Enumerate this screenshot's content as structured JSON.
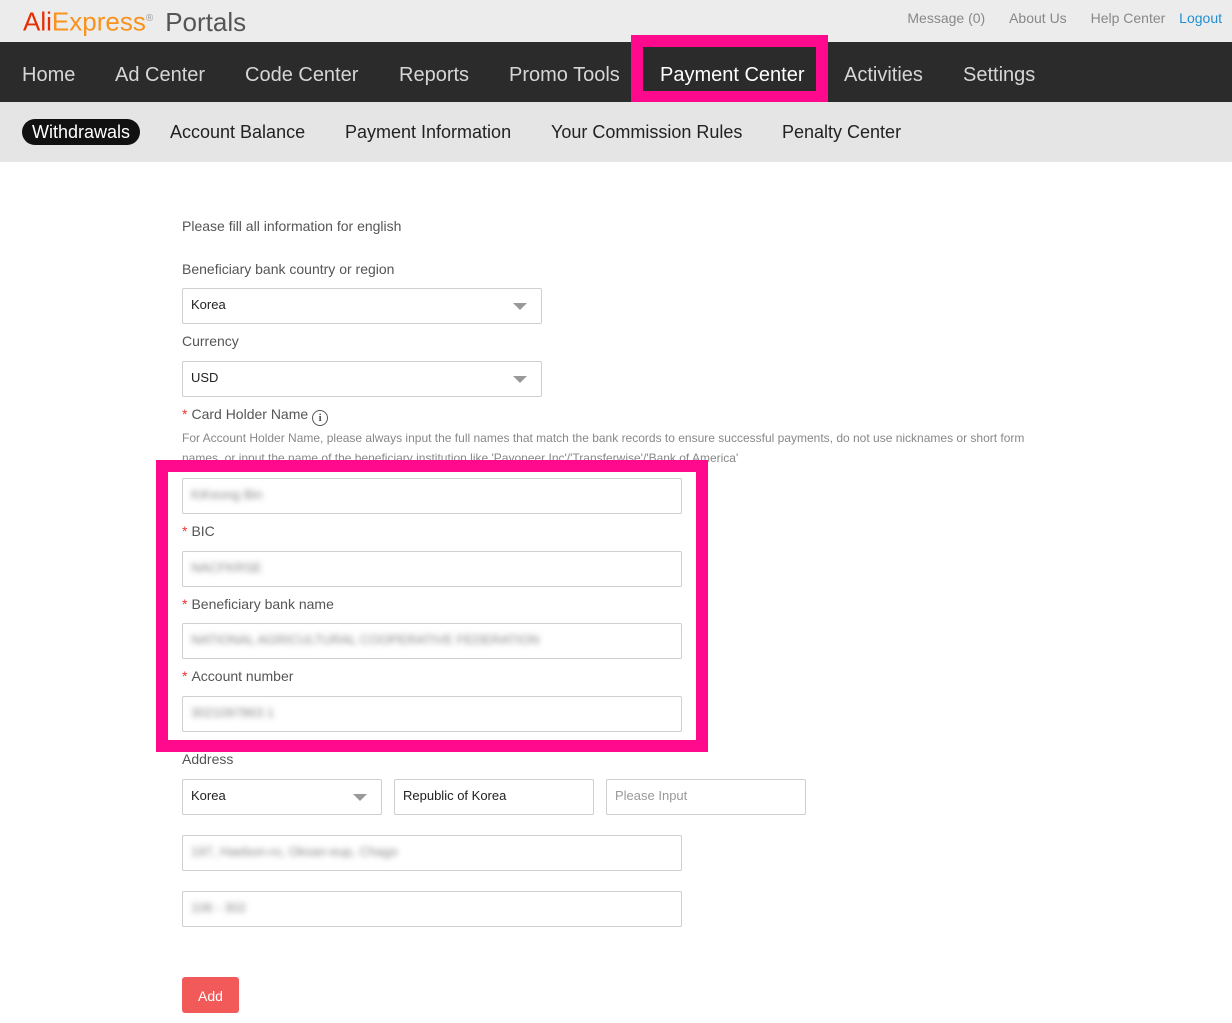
{
  "header": {
    "logo_ali": "Ali",
    "logo_express": "Express",
    "logo_reg": "®",
    "logo_portals": "Portals",
    "links": {
      "message": "Message (0)",
      "about": "About Us",
      "help": "Help Center",
      "logout": "Logout"
    }
  },
  "main_nav": [
    "Home",
    "Ad Center",
    "Code Center",
    "Reports",
    "Promo Tools",
    "Payment Center",
    "Activities",
    "Settings"
  ],
  "sub_nav": [
    "Withdrawals",
    "Account Balance",
    "Payment Information",
    "Your Commission Rules",
    "Penalty Center"
  ],
  "form": {
    "intro": "Please fill all information for english",
    "country_label": "Beneficiary bank country or region",
    "country_value": "Korea",
    "currency_label": "Currency",
    "currency_value": "USD",
    "required_mark": "*",
    "holder_label": "Card Holder Name",
    "holder_hint": "For Account Holder Name, please always input the full names that match the bank records to ensure successful payments, do not use nicknames or short form names, or input the name of the beneficiary institution like 'Payoneer Inc'/'Transferwise'/'Bank of America'",
    "holder_value": "KiKeong Bin",
    "bic_label": "BIC",
    "bic_value": "NACFKRSE",
    "bank_label": "Beneficiary bank name",
    "bank_value": "NATIONAL AGRICULTURAL COOPERATIVE FEDERATION",
    "account_label": "Account number",
    "account_value": "3021097863 1",
    "address_label": "Address",
    "address_country": "Korea",
    "address_region": "Republic of Korea",
    "address_city_placeholder": "Please Input",
    "address_line1": "197, Haebon-ro, Oksan-eup, Chago",
    "address_line2": "106 - 302",
    "add_button": "Add"
  },
  "colors": {
    "highlight": "#ff0a8c",
    "nav_bg": "#2b2b2b",
    "add_button": "#f25a5a",
    "logout_link": "#1f8fd1"
  }
}
